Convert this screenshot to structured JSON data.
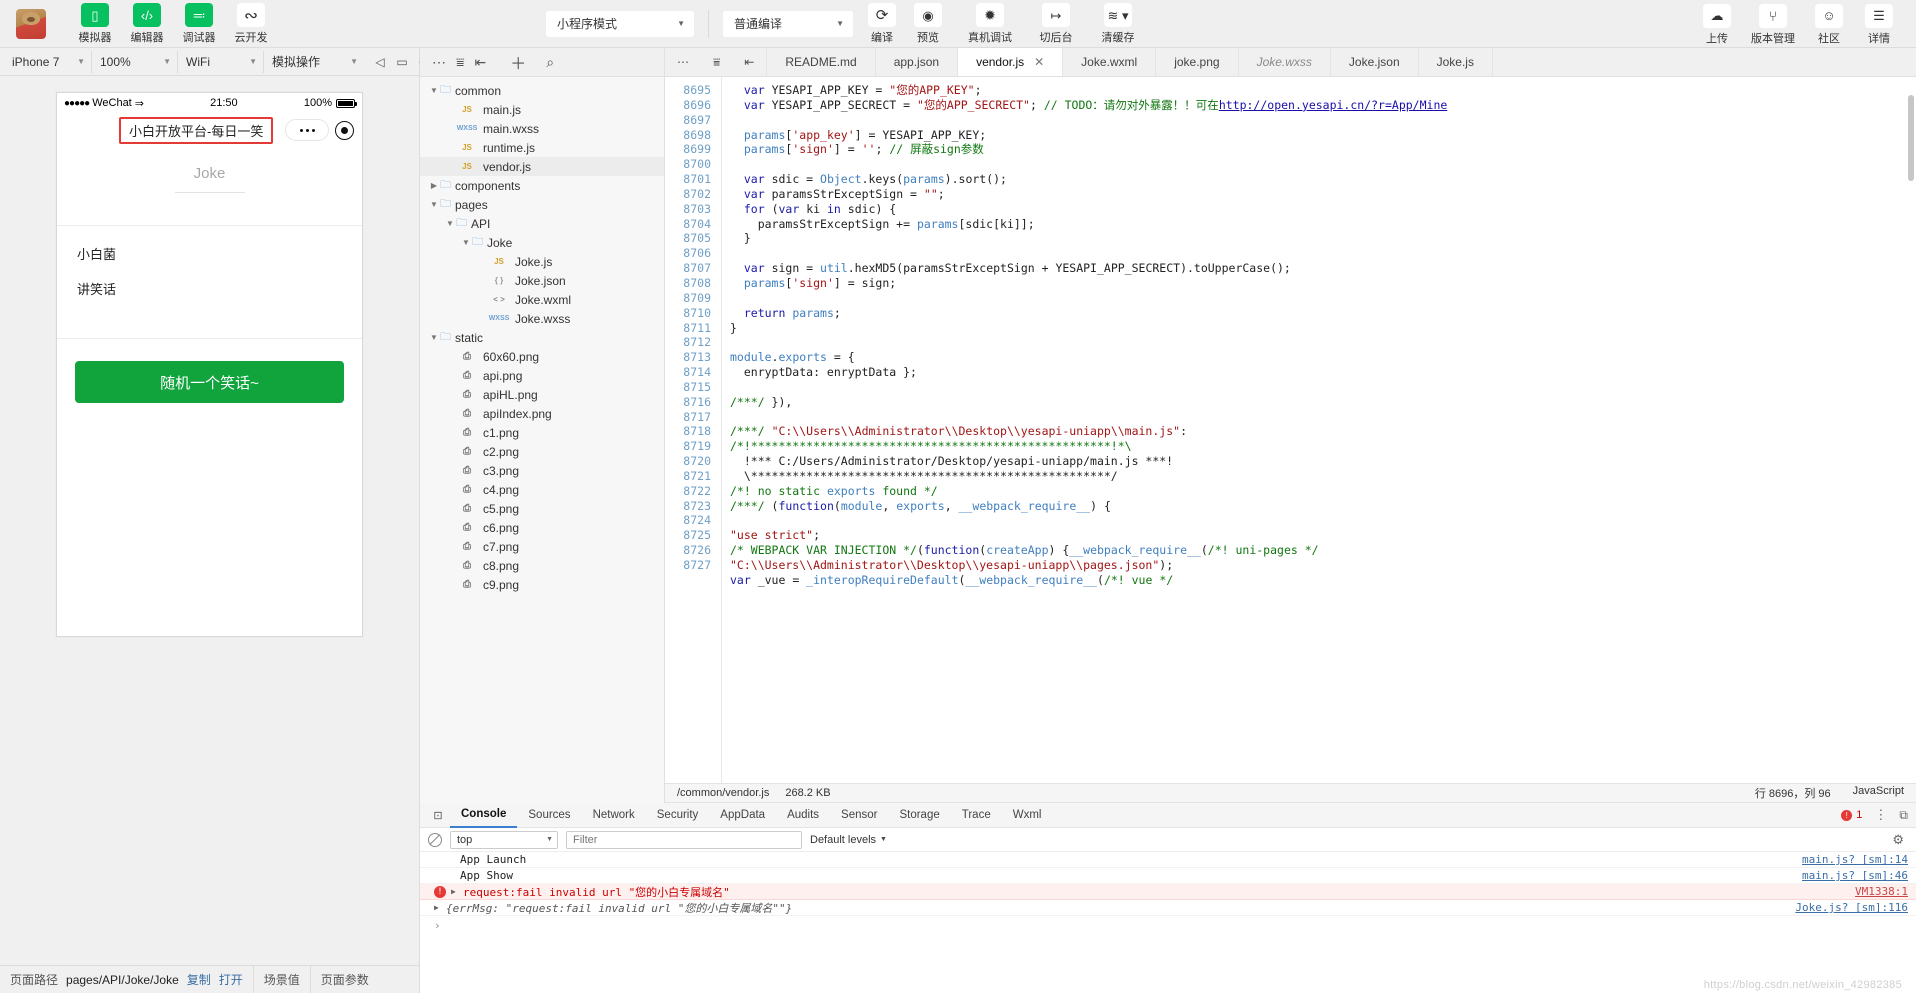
{
  "toolbar": {
    "avatar_name": "user-avatar",
    "buttons": [
      {
        "label": "模拟器",
        "icon": "phone-icon",
        "style": "green",
        "glyph": "▯"
      },
      {
        "label": "编辑器",
        "icon": "code-icon",
        "style": "green",
        "glyph": "‹/›"
      },
      {
        "label": "调试器",
        "icon": "debug-icon",
        "style": "green",
        "glyph": "≕"
      },
      {
        "label": "云开发",
        "icon": "cloud-dev-icon",
        "style": "plain",
        "glyph": "∾"
      }
    ],
    "mode_select": "小程序模式",
    "compile_select": "普通编译",
    "actions": [
      {
        "label": "编译",
        "icon": "refresh-icon",
        "glyph": "⟳"
      },
      {
        "label": "预览",
        "icon": "eye-icon",
        "glyph": "◉"
      },
      {
        "label": "真机调试",
        "icon": "bug-icon",
        "glyph": "✹"
      },
      {
        "label": "切后台",
        "icon": "switch-background-icon",
        "glyph": "↦"
      },
      {
        "label": "清缓存",
        "icon": "layers-icon",
        "glyph": "≋"
      }
    ],
    "right_actions": [
      {
        "label": "上传",
        "icon": "upload-cloud-icon",
        "glyph": "☁"
      },
      {
        "label": "版本管理",
        "icon": "git-branch-icon",
        "glyph": "⑂"
      },
      {
        "label": "社区",
        "icon": "chat-bubble-icon",
        "glyph": "☺"
      },
      {
        "label": "详情",
        "icon": "menu-icon",
        "glyph": "☰"
      }
    ]
  },
  "simulator": {
    "device": "iPhone 7",
    "zoom": "100%",
    "network": "WiFi",
    "operation": "模拟操作",
    "icons": [
      "mute-icon",
      "rotate-icon",
      "screenshot-icon"
    ],
    "status_bar": {
      "signal_dots": "●●●●●",
      "carrier": "WeChat",
      "wifi": "⇒",
      "time": "21:50",
      "battery_text": "100%"
    },
    "nav_title": "小白开放平台-每日一笑",
    "page": {
      "heading": "Joke",
      "line1": "小白菌",
      "line2": "讲笑话",
      "button": "随机一个笑话~"
    },
    "footer": {
      "path_label": "页面路径",
      "path_value": "pages/API/Joke/Joke",
      "copy": "复制",
      "open": "打开",
      "scene": "场景值",
      "params": "页面参数"
    }
  },
  "filetree": {
    "toolbar_icons": [
      "collapse-icon",
      "window-icon",
      "format-icon",
      "add-file-icon",
      "search-icon"
    ],
    "nodes": [
      {
        "indent": 0,
        "arrow": "▼",
        "type": "folder",
        "name": "common"
      },
      {
        "indent": 1,
        "arrow": "",
        "type": "js",
        "name": "main.js"
      },
      {
        "indent": 1,
        "arrow": "",
        "type": "wxss",
        "name": "main.wxss"
      },
      {
        "indent": 1,
        "arrow": "",
        "type": "js",
        "name": "runtime.js"
      },
      {
        "indent": 1,
        "arrow": "",
        "type": "js",
        "name": "vendor.js",
        "selected": true
      },
      {
        "indent": 0,
        "arrow": "▶",
        "type": "folder",
        "name": "components"
      },
      {
        "indent": 0,
        "arrow": "▼",
        "type": "folder",
        "name": "pages"
      },
      {
        "indent": 1,
        "arrow": "▼",
        "type": "folder",
        "name": "API"
      },
      {
        "indent": 2,
        "arrow": "▼",
        "type": "folder",
        "name": "Joke"
      },
      {
        "indent": 3,
        "arrow": "",
        "type": "js",
        "name": "Joke.js"
      },
      {
        "indent": 3,
        "arrow": "",
        "type": "json",
        "name": "Joke.json"
      },
      {
        "indent": 3,
        "arrow": "",
        "type": "wxml",
        "name": "Joke.wxml"
      },
      {
        "indent": 3,
        "arrow": "",
        "type": "wxss",
        "name": "Joke.wxss"
      },
      {
        "indent": 0,
        "arrow": "▼",
        "type": "folder",
        "name": "static"
      },
      {
        "indent": 1,
        "arrow": "",
        "type": "png",
        "name": "60x60.png"
      },
      {
        "indent": 1,
        "arrow": "",
        "type": "png",
        "name": "api.png"
      },
      {
        "indent": 1,
        "arrow": "",
        "type": "png",
        "name": "apiHL.png"
      },
      {
        "indent": 1,
        "arrow": "",
        "type": "png",
        "name": "apiIndex.png"
      },
      {
        "indent": 1,
        "arrow": "",
        "type": "png",
        "name": "c1.png"
      },
      {
        "indent": 1,
        "arrow": "",
        "type": "png",
        "name": "c2.png"
      },
      {
        "indent": 1,
        "arrow": "",
        "type": "png",
        "name": "c3.png"
      },
      {
        "indent": 1,
        "arrow": "",
        "type": "png",
        "name": "c4.png"
      },
      {
        "indent": 1,
        "arrow": "",
        "type": "png",
        "name": "c5.png"
      },
      {
        "indent": 1,
        "arrow": "",
        "type": "png",
        "name": "c6.png"
      },
      {
        "indent": 1,
        "arrow": "",
        "type": "png",
        "name": "c7.png"
      },
      {
        "indent": 1,
        "arrow": "",
        "type": "png",
        "name": "c8.png"
      },
      {
        "indent": 1,
        "arrow": "",
        "type": "png",
        "name": "c9.png"
      }
    ]
  },
  "editor": {
    "tab_icons": [
      "more-icon",
      "outline-icon",
      "split-icon"
    ],
    "tabs": [
      {
        "label": "README.md",
        "active": false,
        "closable": false
      },
      {
        "label": "app.json",
        "active": false,
        "closable": false
      },
      {
        "label": "vendor.js",
        "active": true,
        "closable": true
      },
      {
        "label": "Joke.wxml",
        "active": false,
        "closable": false
      },
      {
        "label": "joke.png",
        "active": false,
        "closable": false
      },
      {
        "label": "Joke.wxss",
        "active": false,
        "closable": false,
        "italic": true
      },
      {
        "label": "Joke.json",
        "active": false,
        "closable": false
      },
      {
        "label": "Joke.js",
        "active": false,
        "closable": false
      }
    ],
    "first_line": 8695,
    "lines": [
      "  var YESAPI_APP_KEY = \"您的APP_KEY\";",
      "  var YESAPI_APP_SECRECT = \"您的APP_SECRECT\"; // TODO：请勿对外暴露！！可在http://open.yesapi.cn/?r=App/Mine",
      "",
      "  params['app_key'] = YESAPI_APP_KEY;",
      "  params['sign'] = ''; // 屏蔽sign参数",
      "",
      "  var sdic = Object.keys(params).sort();",
      "  var paramsStrExceptSign = \"\";",
      "  for (var ki in sdic) {",
      "    paramsStrExceptSign += params[sdic[ki]];",
      "  }",
      "",
      "  var sign = util.hexMD5(paramsStrExceptSign + YESAPI_APP_SECRECT).toUpperCase();",
      "  params['sign'] = sign;",
      "",
      "  return params;",
      "}",
      "",
      "module.exports = {",
      "  enryptData: enryptData };",
      "",
      "/***/ }),",
      "",
      "/***/ \"C:\\\\Users\\\\Administrator\\\\Desktop\\\\yesapi-uniapp\\\\main.js\":",
      "/*!****************************************************!*\\",
      "  !*** C:/Users/Administrator/Desktop/yesapi-uniapp/main.js ***!",
      "  \\****************************************************/",
      "/*! no static exports found */",
      "/***/ (function(module, exports, __webpack_require__) {",
      "",
      "\"use strict\";",
      "/* WEBPACK VAR INJECTION */(function(createApp) {__webpack_require__(/*! uni-pages */",
      "\"C:\\\\Users\\\\Administrator\\\\Desktop\\\\yesapi-uniapp\\\\pages.json\");",
      "var _vue = _interopRequireDefault(__webpack_require__(/*! vue */"
    ],
    "status": {
      "file_path": "/common/vendor.js",
      "file_size": "268.2 KB",
      "cursor": "行 8696，列 96",
      "language": "JavaScript"
    }
  },
  "console": {
    "tabs": [
      "Console",
      "Sources",
      "Network",
      "Security",
      "AppData",
      "Audits",
      "Sensor",
      "Storage",
      "Trace",
      "Wxml"
    ],
    "active_tab": "Console",
    "error_count": "1",
    "context": "top",
    "filter_placeholder": "Filter",
    "levels": "Default levels",
    "right_icons": [
      "more-vert-icon",
      "dock-icon",
      "settings-gear-icon"
    ],
    "messages": [
      {
        "kind": "log",
        "text": "App Launch",
        "source": "main.js? [sm]:14"
      },
      {
        "kind": "log",
        "text": "App Show",
        "source": "main.js? [sm]:46"
      },
      {
        "kind": "error",
        "text": "request:fail invalid url \"您的小白专属域名\"",
        "source": "VM1338:1"
      },
      {
        "kind": "obj",
        "text": "{errMsg: \"request:fail invalid url \"您的小白专属域名\"\"}",
        "source": "Joke.js? [sm]:116"
      }
    ],
    "prompt": "›"
  },
  "watermark": "https://blog.csdn.net/weixin_42982385"
}
